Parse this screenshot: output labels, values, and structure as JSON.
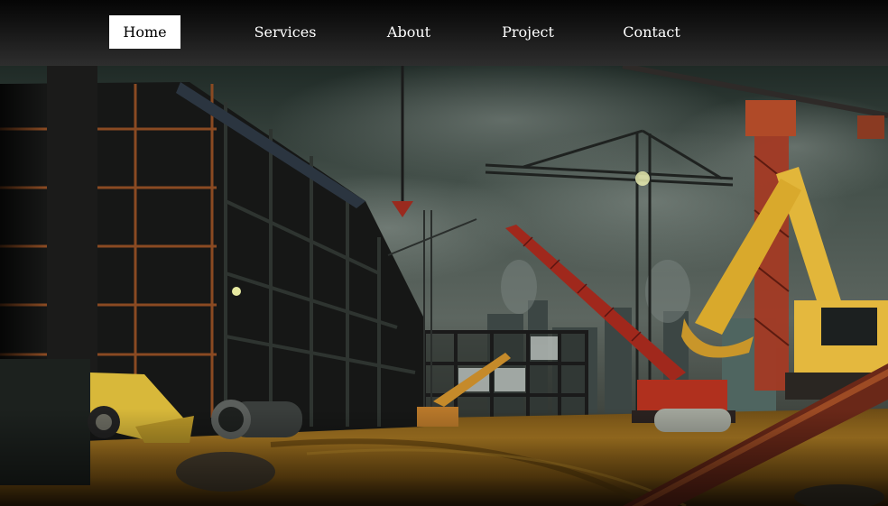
{
  "nav": {
    "items": [
      {
        "label": "Home",
        "active": true
      },
      {
        "label": "Services",
        "active": false
      },
      {
        "label": "About",
        "active": false
      },
      {
        "label": "Project",
        "active": false
      },
      {
        "label": "Contact",
        "active": false
      }
    ]
  },
  "hero": {
    "image": "construction-site-illustration"
  },
  "colors": {
    "nav_bg_top": "#050505",
    "nav_bg_bottom": "#2e2e2e",
    "nav_text": "#ffffff",
    "active_bg": "#ffffff",
    "active_text": "#000000",
    "sky": "#3a4540",
    "ground": "#a0701c",
    "crane_red": "#a0281c",
    "excavator_yellow": "#e2b63a"
  }
}
